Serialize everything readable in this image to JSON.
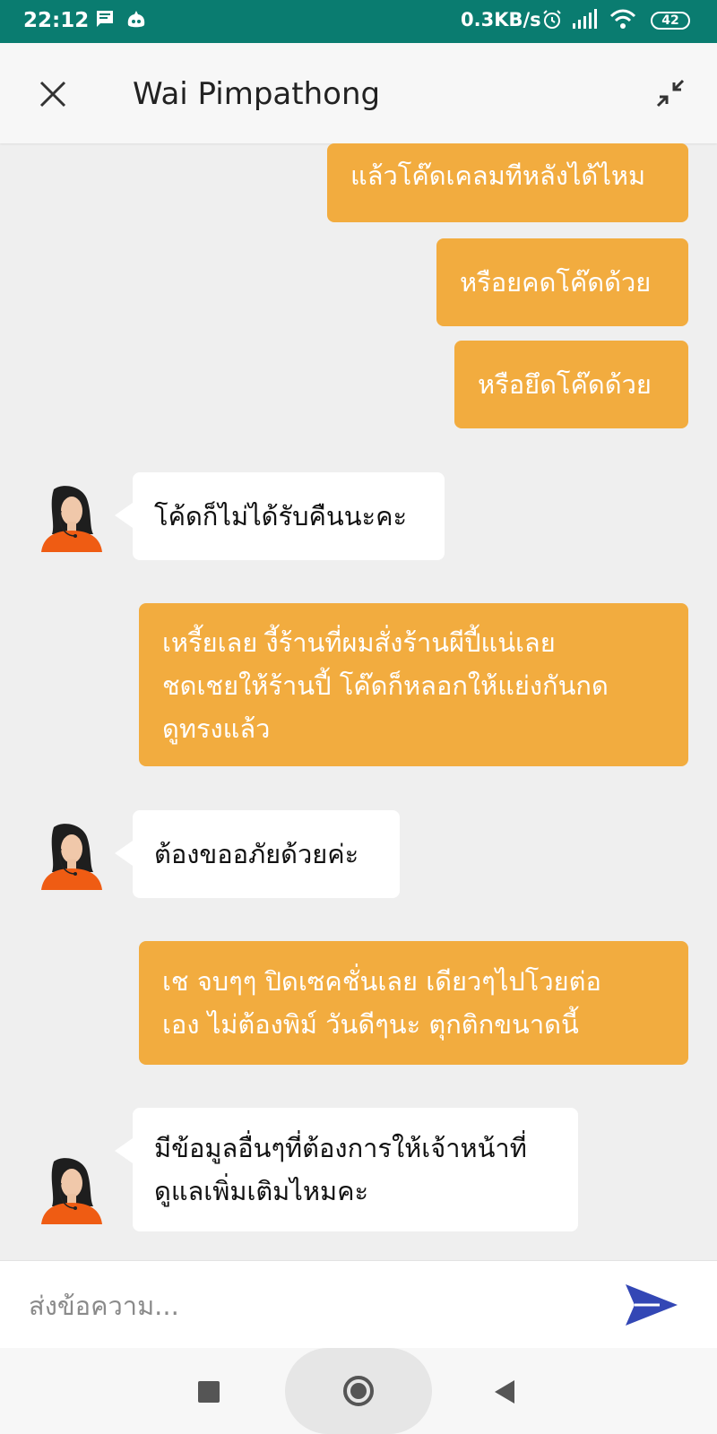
{
  "status_bar": {
    "time": "22:12",
    "net_speed": "0.3KB/s",
    "battery": "42",
    "bg_color": "#0a7c70"
  },
  "header": {
    "title": "Wai Pimpathong",
    "close_icon": "close-icon",
    "minimize_icon": "minimize-icon"
  },
  "messages": [
    {
      "from": "user",
      "lines": [
        "แล้วโค๊ดเคลมทีหลังได้ไหม"
      ]
    },
    {
      "from": "user",
      "lines": [
        "หรือยคดโค๊ดด้วย"
      ]
    },
    {
      "from": "user",
      "lines": [
        "หรือยึดโค๊ดด้วย"
      ]
    },
    {
      "from": "agent",
      "lines": [
        "โค้ดก็ไม่ได้รับคืนนะคะ"
      ]
    },
    {
      "from": "user",
      "lines": [
        "เหรี้ยเลย งี้ร้านที่ผมสั่งร้านผีปี้แน่เลย",
        "ชดเชยให้ร้านปี้ โค๊ดก็หลอกให้แย่งกันกด",
        "ดูทรงแล้ว"
      ]
    },
    {
      "from": "agent",
      "lines": [
        "ต้องขออภัยด้วยค่ะ"
      ]
    },
    {
      "from": "user",
      "lines": [
        "เช จบๆๆ ปิดเซคชั่นเลย เดียวๆไปโวยต่อ",
        "เอง ไม่ต้องพิม์ วันดีๆนะ ตุกติกขนาดนี้"
      ]
    },
    {
      "from": "agent",
      "lines": [
        "มีข้อมูลอื่นๆที่ต้องการให้เจ้าหน้าที่",
        "ดูแลเพิ่มเติมไหมคะ"
      ]
    }
  ],
  "input": {
    "placeholder": "ส่งข้อความ...",
    "value": ""
  },
  "colors": {
    "sent_bubble": "#f2ac3f",
    "received_bubble": "#ffffff",
    "chat_background": "#efefef",
    "send_icon": "#3347b5"
  },
  "nav": {
    "recent_icon": "square-icon",
    "home_icon": "circle-icon",
    "back_icon": "triangle-back-icon"
  }
}
